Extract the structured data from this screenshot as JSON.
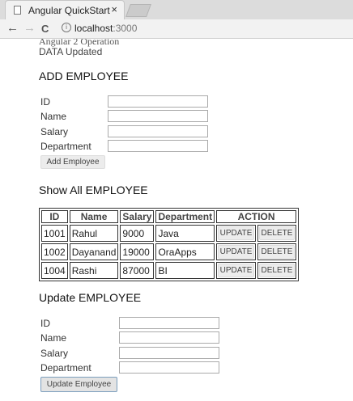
{
  "browser": {
    "tab_title": "Angular QuickStart",
    "tab_close": "×",
    "url_host": "localhost",
    "url_port": ":3000",
    "back": "←",
    "forward": "→",
    "reload": "C"
  },
  "page": {
    "heading": "Angular 2 Operation",
    "status": "DATA Updated"
  },
  "add_form": {
    "title": "ADD EMPLOYEE",
    "labels": [
      "ID",
      "Name",
      "Salary",
      "Department"
    ],
    "values": [
      "",
      "",
      "",
      ""
    ],
    "button": "Add Employee"
  },
  "table": {
    "title": "Show All EMPLOYEE",
    "headers": [
      "ID",
      "Name",
      "Salary",
      "Department",
      "ACTION"
    ],
    "rows": [
      {
        "id": "1001",
        "name": "Rahul",
        "salary": "9000",
        "department": "Java"
      },
      {
        "id": "1002",
        "name": "Dayanand",
        "salary": "19000",
        "department": "OraApps"
      },
      {
        "id": "1004",
        "name": "Rashi",
        "salary": "87000",
        "department": "BI"
      }
    ],
    "update_label": "UPDATE",
    "delete_label": "DELETE"
  },
  "update_form": {
    "title": "Update EMPLOYEE",
    "labels": [
      "ID",
      "Name",
      "Salary",
      "Department"
    ],
    "values": [
      "",
      "",
      "",
      ""
    ],
    "button": "Update Employee"
  }
}
